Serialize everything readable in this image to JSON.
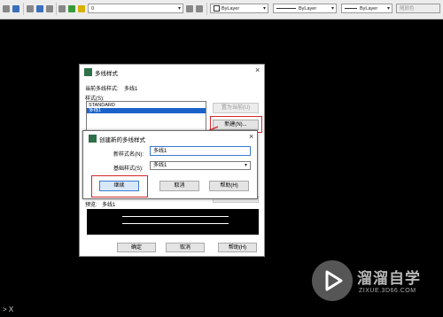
{
  "toolbar": {
    "layer_value": "0",
    "color_value": "ByLayer",
    "linetype_value": "ByLayer",
    "lineweight_value": "ByLayer",
    "textstyle_value": "Standard",
    "dimstyle_value": "ISO-25",
    "tablestyle_value": "Standard",
    "plotstyle_value": "随颜色"
  },
  "mline_dialog": {
    "title": "多线样式",
    "current_style_label": "当前多线样式:",
    "current_style_value": "多线1",
    "styles_label": "样式(S):",
    "styles": [
      "STANDARD",
      "多线1"
    ],
    "selected_style_index": 1,
    "set_current_button": "置为当前(U)",
    "new_button": "新建(N)...",
    "preview_label": "预览:",
    "preview_value": "多线1",
    "ok_button": "确定",
    "cancel_button": "取消",
    "help_button": "帮助(H)"
  },
  "new_dialog": {
    "title": "创建新的多线样式",
    "close_icon": "×",
    "new_name_label": "新样式名(N):",
    "new_name_value": "多线1",
    "base_style_label": "基础样式(S):",
    "base_style_value": "多线1",
    "continue_button": "继续",
    "cancel_button": "取消",
    "help_button": "帮助(H)"
  },
  "main_dialog_close": "×",
  "command_line": {
    "prompt": "> X"
  },
  "watermark": {
    "brand": "溜溜自学",
    "url": "ZIXUE.3D66.COM"
  },
  "colors": {
    "highlight_red": "#d2282b",
    "selection_blue": "#1a62c9"
  }
}
